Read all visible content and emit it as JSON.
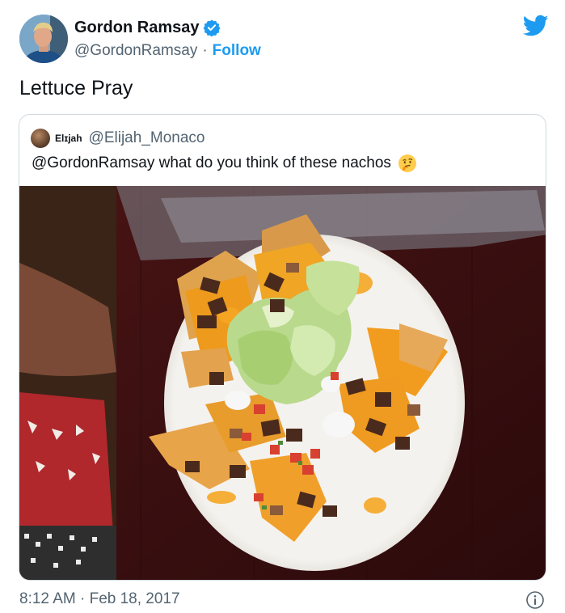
{
  "tweet": {
    "author": {
      "display_name": "Gordon Ramsay",
      "handle": "@GordonRamsay",
      "separator": "·",
      "follow_label": "Follow",
      "verified_icon": "verified-badge-icon"
    },
    "text": "Lettuce Pray",
    "timestamp": "8:12 AM · Feb 18, 2017",
    "brand_icon": "twitter-bird-icon",
    "info_icon": "info-icon"
  },
  "quoted_tweet": {
    "display_name": "Elɪjah",
    "handle": "@Elijah_Monaco",
    "text": "@GordonRamsay what do you think of these nachos",
    "emoji": "thinking-face-emoji",
    "image_subject": "nachos-on-plate"
  },
  "colors": {
    "accent": "#1d9bf0",
    "text_primary": "#0f1419",
    "text_secondary": "#536471",
    "border": "#cfd9de"
  }
}
